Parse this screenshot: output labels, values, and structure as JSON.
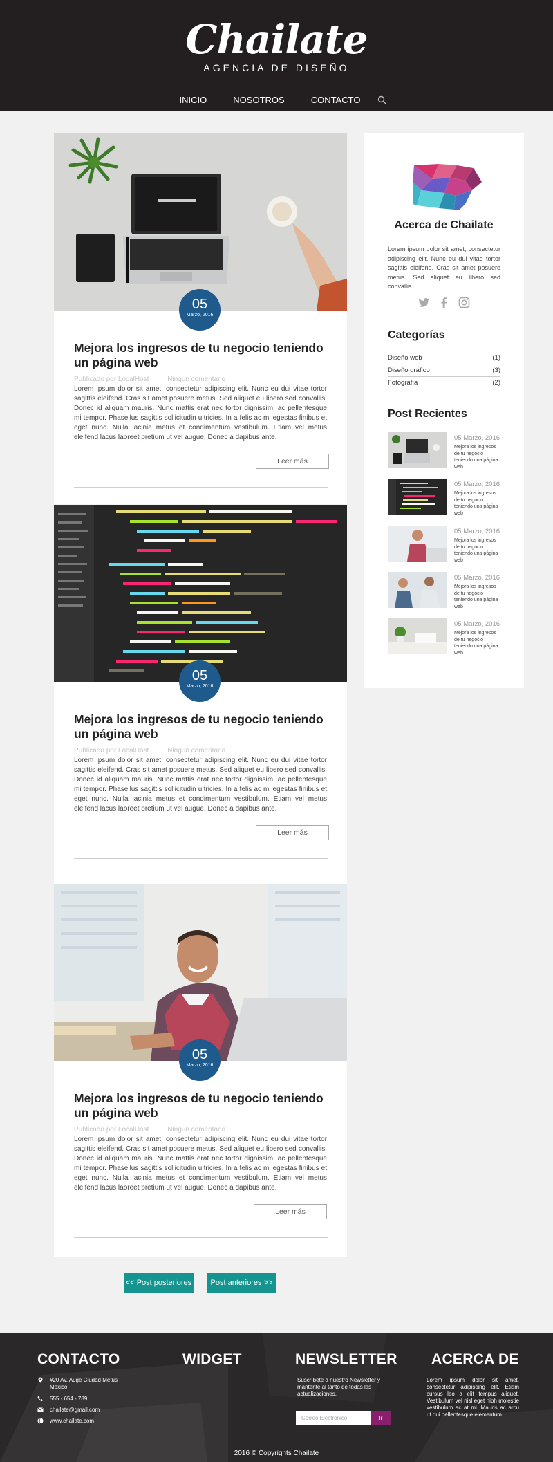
{
  "header": {
    "logo": "Chailate",
    "tagline": "AGENCIA DE DISEÑO",
    "nav": [
      "INICIO",
      "NOSOTROS",
      "CONTACTO"
    ]
  },
  "posts": [
    {
      "day": "05",
      "month": "Marzo, 2016",
      "title": "Mejora los ingresos de tu negocio  teniendo un página web",
      "author": "Publicado por LocalHost",
      "comments": "Ningun comentario",
      "excerpt": "Lorem ipsum dolor sit amet, consectetur adipiscing elit. Nunc eu dui vitae tortor sagittis eleifend. Cras sit amet posuere metus. Sed aliquet eu libero sed convallis. Donec id aliquam mauris. Nunc mattis erat nec tortor dignissim, ac pellentesque mi tempor. Phasellus sagittis sollicitudin ultricies. In a felis ac mi egestas finibus et eget nunc. Nulla lacinia metus et condimentum vestibulum. Etiam vel metus eleifend lacus laoreet pretium ut vel augue. Donec a dapibus ante.",
      "button": "Leer más"
    },
    {
      "day": "05",
      "month": "Marzo, 2016",
      "title": "Mejora los ingresos de tu negocio  teniendo un página web",
      "author": "Publicado por LocalHost",
      "comments": "Ningun comentario",
      "excerpt": "Lorem ipsum dolor sit amet, consectetur adipiscing elit. Nunc eu dui vitae tortor sagittis eleifend. Cras sit amet posuere metus. Sed aliquet eu libero sed convallis. Donec id aliquam mauris. Nunc mattis erat nec tortor dignissim, ac pellentesque mi tempor. Phasellus sagittis sollicitudin ultricies. In a felis ac mi egestas finibus et eget nunc. Nulla lacinia metus et condimentum vestibulum. Etiam vel metus eleifend lacus laoreet pretium ut vel augue. Donec a dapibus ante.",
      "button": "Leer más"
    },
    {
      "day": "05",
      "month": "Marzo, 2016",
      "title": "Mejora los ingresos de tu negocio  teniendo un página web",
      "author": "Publicado por LocalHost",
      "comments": "Ningun comentario",
      "excerpt": "Lorem ipsum dolor sit amet, consectetur adipiscing elit. Nunc eu dui vitae tortor sagittis eleifend. Cras sit amet posuere metus. Sed aliquet eu libero sed convallis. Donec id aliquam mauris. Nunc mattis erat nec tortor dignissim, ac pellentesque mi tempor. Phasellus sagittis sollicitudin ultricies. In a felis ac mi egestas finibus et eget nunc. Nulla lacinia metus et condimentum vestibulum. Etiam vel metus eleifend lacus laoreet pretium ut vel augue. Donec a dapibus ante.",
      "button": "Leer más"
    }
  ],
  "sidebar": {
    "about_title": "Acerca de Chailate",
    "about_text": "Lorem ipsum dolor sit amet, consectetur adipiscing elit. Nunc eu dui vitae tortor sagittis eleifend. Cras sit amet posuere metus. Sed aliquet eu libero sed convallis.",
    "social_icons": [
      "twitter-icon",
      "facebook-icon",
      "instagram-icon"
    ],
    "categories_title": "Categorías",
    "categories": [
      {
        "name": "Diseño web",
        "count": "(1)"
      },
      {
        "name": "Diseño gráfico",
        "count": "(3)"
      },
      {
        "name": "Fotografía",
        "count": "(2)"
      }
    ],
    "recent_title": "Post Recientes",
    "recent": [
      {
        "date": "05 Marzo, 2016",
        "title": "Mejora los ingresos de tu negocio teniendo una página web"
      },
      {
        "date": "05 Marzo, 2016",
        "title": "Mejora los ingresos de tu negocio teniendo una página web"
      },
      {
        "date": "05 Marzo, 2016",
        "title": "Mejora los ingresos de tu negocio teniendo una página web"
      },
      {
        "date": "05 Marzo, 2016",
        "title": "Mejora los ingresos de tu negocio teniendo una página web"
      },
      {
        "date": "05 Marzo, 2016",
        "title": "Mejora los ingresos de tu negocio teniendo una página web"
      }
    ]
  },
  "pagination": {
    "newer": "<< Post posteriores",
    "older": "Post anteriores >>"
  },
  "footer": {
    "contact_title": "CONTACTO",
    "address": "#20 Av. Auge Ciudad Metus México",
    "phone": "555 - 654 - 789",
    "email": "chailate@gmail.com",
    "website": "www.chailate.com",
    "widget_title": "WIDGET",
    "newsletter_title": "NEWSLETTER",
    "newsletter_text": "Suscríbete a nuestro Newsletter y mantente al tanto de todas las actualizaciones.",
    "email_placeholder": "Correo Electrónico",
    "go_label": "Ir",
    "about_title": "ACERCA DE",
    "about_text": "Lorem ipsum dolor sit amet, consectetur adipiscing elit. Etiam cursus leo a elit tempus aliquet. Vestibulum vel nisl eget nibh molestie vestibulum ac at mi. Mauris ac arcu ut dui pellentesque elementum.",
    "copyright": "2016  © Copyrights  Chailate"
  },
  "colors": {
    "header_bg": "#231f20",
    "date_badge": "#1f5a8c",
    "pagination": "#16948f",
    "newsletter_button": "#8a1f6e"
  }
}
